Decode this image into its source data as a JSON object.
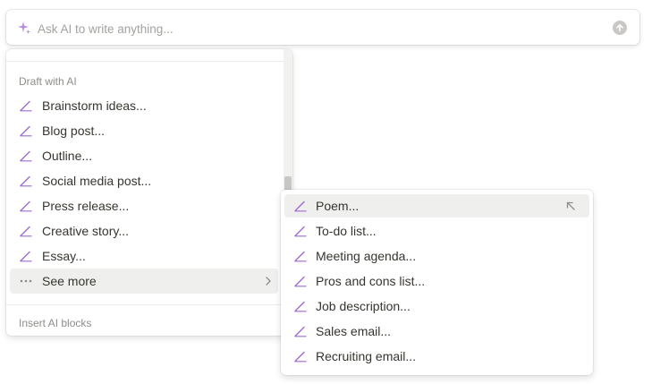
{
  "ai_input": {
    "placeholder": "Ask AI to write anything...",
    "value": ""
  },
  "menu": {
    "section_draft": "Draft with AI",
    "items": [
      {
        "label": "Brainstorm ideas...",
        "icon": "pen-icon"
      },
      {
        "label": "Blog post...",
        "icon": "pen-icon"
      },
      {
        "label": "Outline...",
        "icon": "pen-icon"
      },
      {
        "label": "Social media post...",
        "icon": "pen-icon"
      },
      {
        "label": "Press release...",
        "icon": "pen-icon"
      },
      {
        "label": "Creative story...",
        "icon": "pen-icon"
      },
      {
        "label": "Essay...",
        "icon": "pen-icon"
      },
      {
        "label": "See more",
        "icon": "more-dots-icon"
      }
    ],
    "section_blocks": "Insert AI blocks"
  },
  "submenu": {
    "items": [
      {
        "label": "Poem...",
        "icon": "pen-icon"
      },
      {
        "label": "To-do list...",
        "icon": "pen-icon"
      },
      {
        "label": "Meeting agenda...",
        "icon": "pen-icon"
      },
      {
        "label": "Pros and cons list...",
        "icon": "pen-icon"
      },
      {
        "label": "Job description...",
        "icon": "pen-icon"
      },
      {
        "label": "Sales email...",
        "icon": "pen-icon"
      },
      {
        "label": "Recruiting email...",
        "icon": "pen-icon"
      }
    ]
  },
  "colors": {
    "accent_purple": "#9b6bd3",
    "hover_bg": "#efefee",
    "text": "#37352f",
    "muted": "#8e8d89"
  }
}
